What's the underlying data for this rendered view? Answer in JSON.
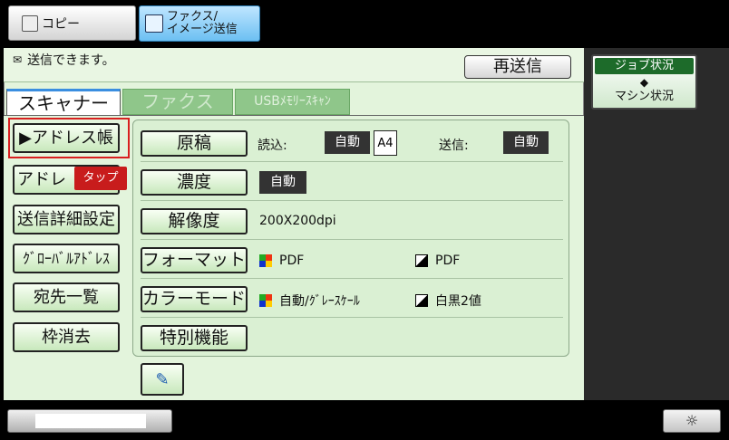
{
  "mode_tabs": [
    {
      "label": "コピー",
      "icon": "copy-icon"
    },
    {
      "label_line1": "ファクス/",
      "label_line2": "イメージ送信",
      "icon": "fax-scan-icon"
    }
  ],
  "status": {
    "message": "送信できます。",
    "resend_label": "再送信",
    "icon": "envelope-icon"
  },
  "scan_tabs": [
    "スキャナー",
    "ファクス",
    "USBﾒﾓﾘｰｽｷｬﾝ"
  ],
  "side_buttons": [
    "▶アドレス帳",
    "アドレ",
    "送信詳細設定",
    "ｸﾞﾛｰﾊﾞﾙｱﾄﾞﾚｽ",
    "宛先一覧",
    "枠消去"
  ],
  "tooltip": "タップ",
  "settings": {
    "original": {
      "label": "原稿",
      "read_label": "読込:",
      "read_value": "自動",
      "size": "A4",
      "send_label": "送信:",
      "send_value": "自動"
    },
    "density": {
      "label": "濃度",
      "value": "自動"
    },
    "resolution": {
      "label": "解像度",
      "value": "200X200dpi"
    },
    "format": {
      "label": "フォーマット",
      "color_value": "PDF",
      "bw_value": "PDF"
    },
    "color_mode": {
      "label": "カラーモード",
      "color_value": "自動/ｸﾞﾚｰｽｹｰﾙ",
      "bw_value": "白黒2値"
    },
    "special": {
      "label": "特別機能"
    }
  },
  "right_panel": {
    "job_status": "ジョブ状況",
    "machine_status": "マシン状況",
    "arrows": "◆"
  },
  "bottom": {
    "brightness_icon": "☼"
  },
  "colors": {
    "panel_green": "#e3f4dc",
    "button_green": "#c8e8bc",
    "fax_tab_blue": "#6cc0f2",
    "highlight_red": "#d92020",
    "dark": "#333333"
  }
}
